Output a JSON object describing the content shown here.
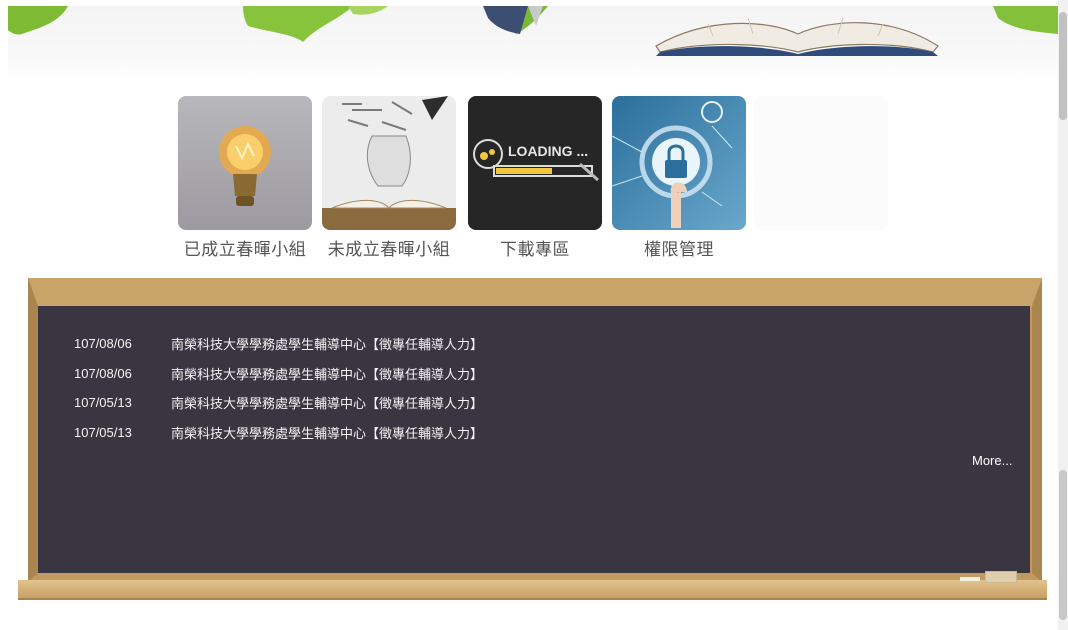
{
  "tiles": [
    {
      "label": "已成立春暉小組",
      "icon": "lightbulb-icon"
    },
    {
      "label": "未成立春暉小組",
      "icon": "book-lightbulb-icon"
    },
    {
      "label": "下載專區",
      "icon": "loading-icon"
    },
    {
      "label": "權限管理",
      "icon": "lock-icon"
    }
  ],
  "loading_text": "LOADING ...",
  "news": [
    {
      "date": "107/08/06",
      "title": "南榮科技大學學務處學生輔導中心【徵專任輔導人力】"
    },
    {
      "date": "107/08/06",
      "title": "南榮科技大學學務處學生輔導中心【徵專任輔導人力】"
    },
    {
      "date": "107/05/13",
      "title": "南榮科技大學學務處學生輔導中心【徵專任輔導人力】"
    },
    {
      "date": "107/05/13",
      "title": "南榮科技大學學務處學生輔導中心【徵專任輔導人力】"
    }
  ],
  "more_label": "More...",
  "colors": {
    "board": "#3a3641",
    "frame": "#c29a5f",
    "text": "#f3f3f3",
    "tile_label": "#555555"
  }
}
